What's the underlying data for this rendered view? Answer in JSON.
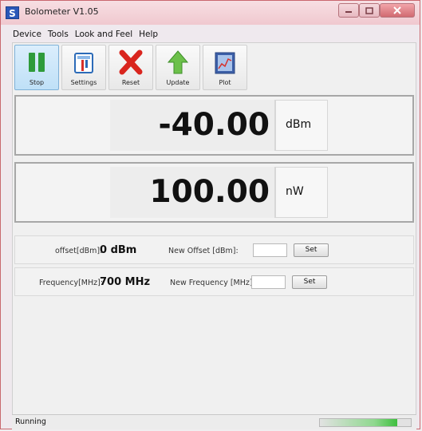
{
  "window": {
    "title": "Bolometer V1.05",
    "app_icon_letter": "S",
    "controls": [
      "minimize-icon",
      "maximize-icon",
      "close-icon"
    ]
  },
  "menu": [
    "Device",
    "Tools",
    "Look and Feel",
    "Help"
  ],
  "toolbar": [
    {
      "label": "Stop",
      "icon": "pause-icon",
      "active": true
    },
    {
      "label": "Settings",
      "icon": "settings-icon",
      "active": false
    },
    {
      "label": "Reset",
      "icon": "reset-x-icon",
      "active": false
    },
    {
      "label": "Update",
      "icon": "update-arrow-icon",
      "active": false
    },
    {
      "label": "Plot",
      "icon": "plot-icon",
      "active": false
    }
  ],
  "readings": {
    "power_dbm": {
      "value": "-40.00",
      "unit": "dBm"
    },
    "power_nw": {
      "value": "100.00",
      "unit": "nW"
    }
  },
  "offset_row": {
    "label": "offset[dBm]:",
    "value": "0 dBm",
    "new_label": "New Offset [dBm]:",
    "input_value": "",
    "button": "Set"
  },
  "frequency_row": {
    "label": "Frequency[MHz]:",
    "value": "700 MHz",
    "new_label": "New Frequency [MHz]:",
    "input_value": "",
    "button": "Set"
  },
  "status": {
    "text": "Running",
    "progress": 0.85
  },
  "colors": {
    "window_border": "#c9686f",
    "close_button": "#d16a71",
    "stop_green": "#2e9b3a",
    "reset_red": "#d9251e",
    "update_green": "#6cc04a",
    "progress_green": "#3fbf3f"
  }
}
